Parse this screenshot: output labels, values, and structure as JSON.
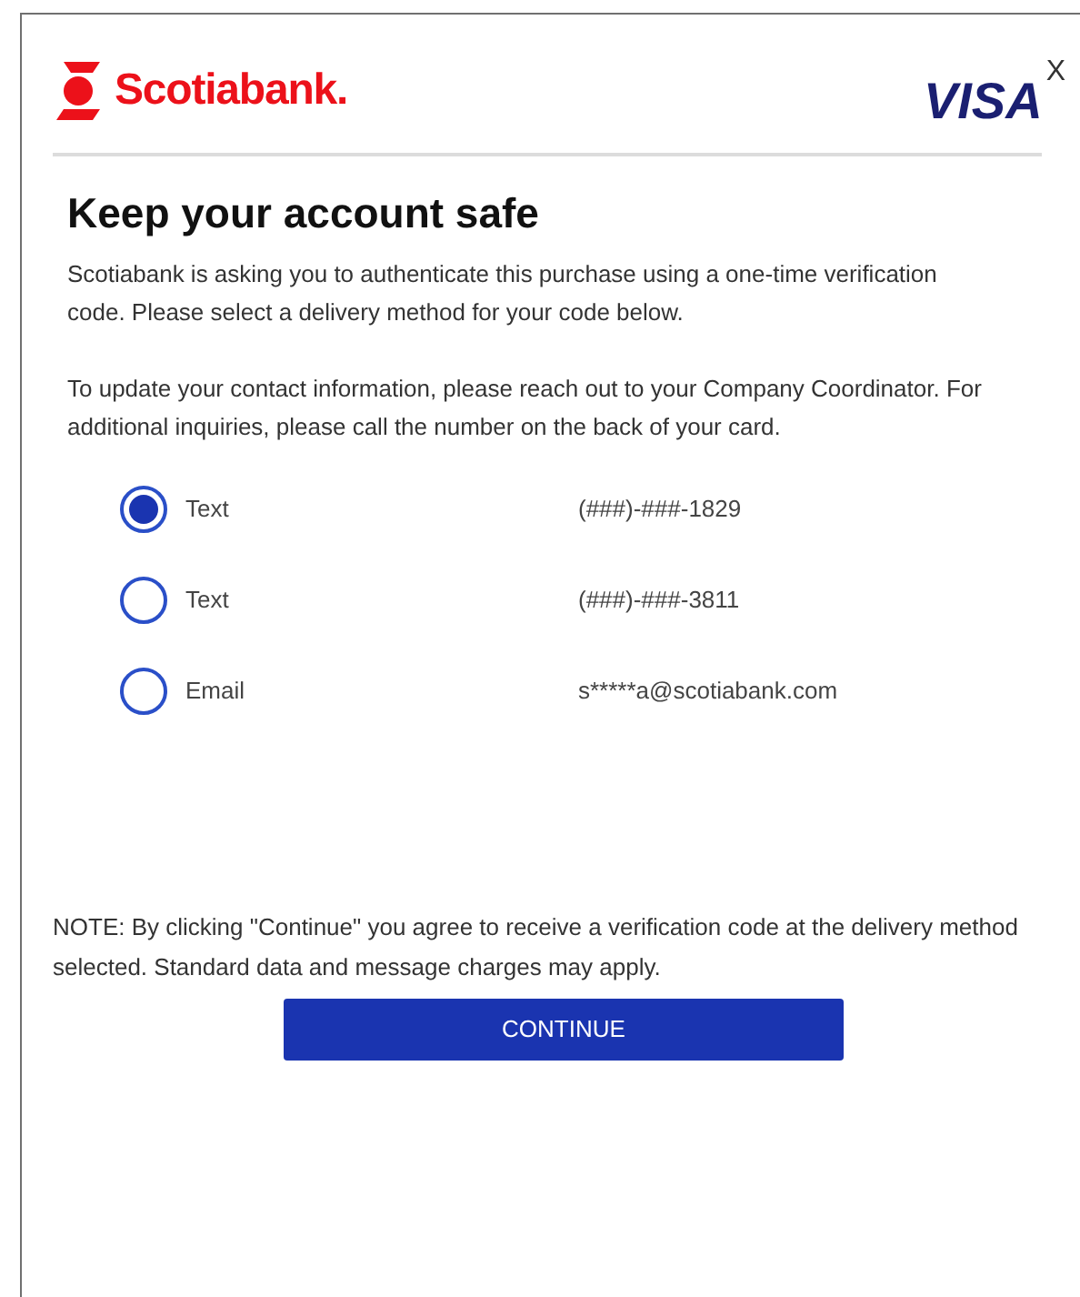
{
  "header": {
    "bank_logo": "Scotiabank.",
    "card_logo": "VISA",
    "close": "X"
  },
  "title": "Keep your account safe",
  "paragraphs": [
    "Scotiabank is asking you to authenticate this purchase using a one-time verification code. Please select a delivery method for your code below.",
    "To update your contact information, please reach out to your Company Coordinator. For additional inquiries, please call the number on the back of your card."
  ],
  "options": [
    {
      "label": "Text",
      "value": "(###)-###-1829",
      "selected": true
    },
    {
      "label": "Text",
      "value": "(###)-###-3811",
      "selected": false
    },
    {
      "label": "Email",
      "value": "s*****a@scotiabank.com",
      "selected": false
    }
  ],
  "note": "NOTE: By clicking \"Continue\" you agree to receive a verification code at the delivery method selected. Standard data and message charges may apply.",
  "button": "CONTINUE"
}
